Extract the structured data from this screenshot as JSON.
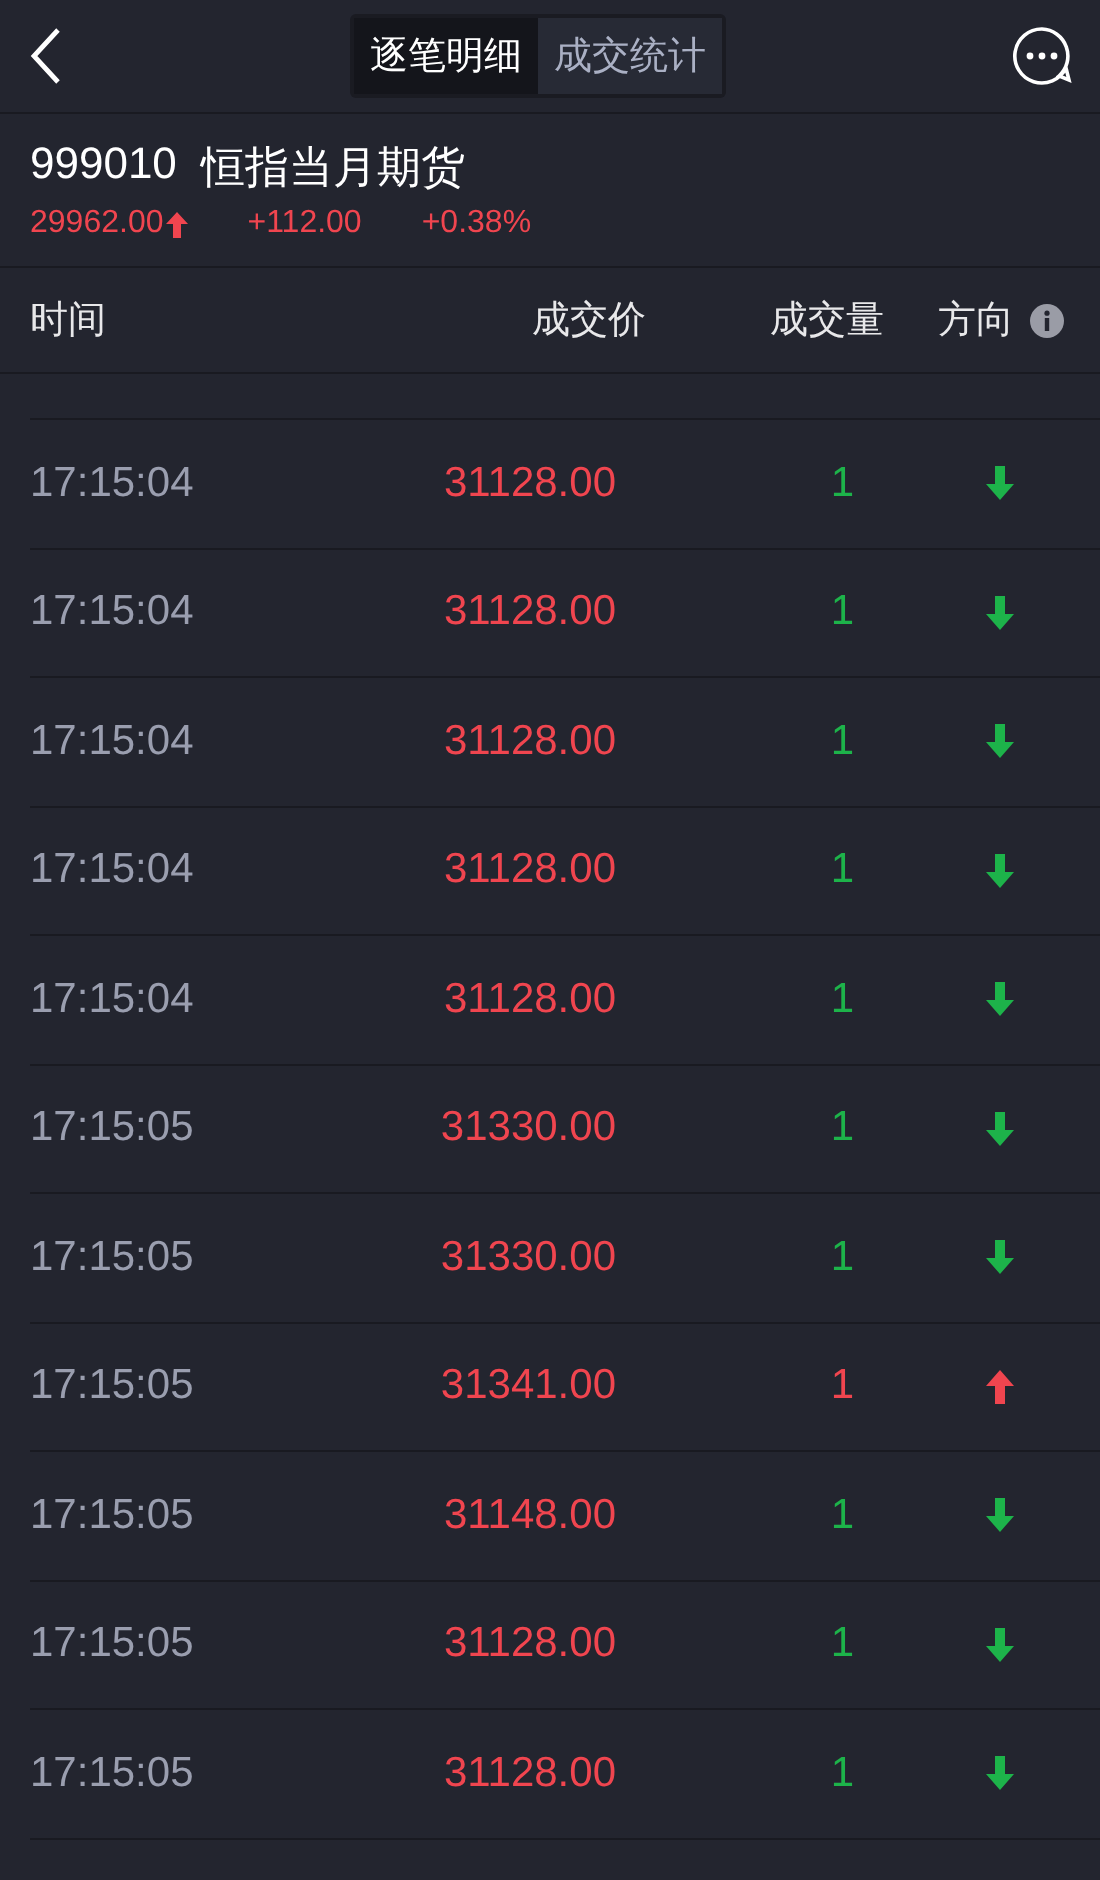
{
  "tabs": [
    {
      "label": "逐笔明细",
      "selected": true
    },
    {
      "label": "成交统计",
      "selected": false
    }
  ],
  "instrument": {
    "code": "999010",
    "name": "恒指当月期货",
    "price": "29962.00",
    "kind": "up",
    "change": "+112.00",
    "change_percent": "+0.38%"
  },
  "table": {
    "columns": [
      "时间",
      "成交价",
      "成交量",
      "方向"
    ],
    "rows": [
      {
        "time": "17:15:04",
        "price": "31128.00",
        "volume": "1",
        "kind": "down"
      },
      {
        "time": "17:15:04",
        "price": "31128.00",
        "volume": "1",
        "kind": "down"
      },
      {
        "time": "17:15:04",
        "price": "31128.00",
        "volume": "1",
        "kind": "down"
      },
      {
        "time": "17:15:04",
        "price": "31128.00",
        "volume": "1",
        "kind": "down"
      },
      {
        "time": "17:15:04",
        "price": "31128.00",
        "volume": "1",
        "kind": "down"
      },
      {
        "time": "17:15:05",
        "price": "31330.00",
        "volume": "1",
        "kind": "down"
      },
      {
        "time": "17:15:05",
        "price": "31330.00",
        "volume": "1",
        "kind": "down"
      },
      {
        "time": "17:15:05",
        "price": "31341.00",
        "volume": "1",
        "kind": "up"
      },
      {
        "time": "17:15:05",
        "price": "31148.00",
        "volume": "1",
        "kind": "down"
      },
      {
        "time": "17:15:05",
        "price": "31128.00",
        "volume": "1",
        "kind": "down"
      },
      {
        "time": "17:15:05",
        "price": "31128.00",
        "volume": "1",
        "kind": "down"
      }
    ]
  }
}
